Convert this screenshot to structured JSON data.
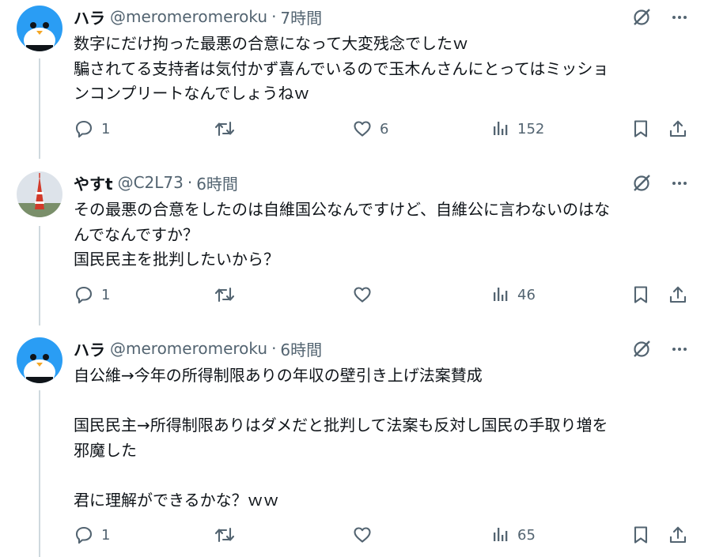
{
  "tweets": [
    {
      "name": "ハラ",
      "handle": "@meromeromeroku",
      "separator": "·",
      "time": "7時間",
      "avatar": "penguin-avatar",
      "body": "数字にだけ拘った最悪の合意になって大変残念でしたｗ\n騙されてる支持者は気付かず喜んでいるので玉木んさんにとってはミッショ\nンコンプリートなんでしょうねｗ",
      "replies": "1",
      "reposts": "",
      "likes": "6",
      "views": "152"
    },
    {
      "name": "やすt",
      "handle": "@C2L73",
      "separator": "·",
      "time": "6時間",
      "avatar": "tokyo-tower-avatar",
      "body": "その最悪の合意をしたのは自維国公なんですけど、自維公に言わないのはな\nんでなんですか？\n国民民主を批判したいから？",
      "replies": "1",
      "reposts": "",
      "likes": "",
      "views": "46"
    },
    {
      "name": "ハラ",
      "handle": "@meromeromeroku",
      "separator": "·",
      "time": "6時間",
      "avatar": "penguin-avatar",
      "body": "自公維→今年の所得制限ありの年収の壁引き上げ法案賛成\n\n国民民主→所得制限ありはダメだと批判して法案も反対し国民の手取り増を\n邪魔した\n\n君に理解ができるかな？ｗｗ",
      "replies": "1",
      "reposts": "",
      "likes": "",
      "views": "65"
    }
  ],
  "colors": {
    "text": "#0f1419",
    "secondary": "#536471",
    "thread_line": "#cfd9de",
    "penguin_blue": "#1d9bf0"
  },
  "icons": [
    "grok-icon",
    "more-icon",
    "reply-icon",
    "repost-icon",
    "like-icon",
    "views-icon",
    "bookmark-icon",
    "share-icon"
  ]
}
